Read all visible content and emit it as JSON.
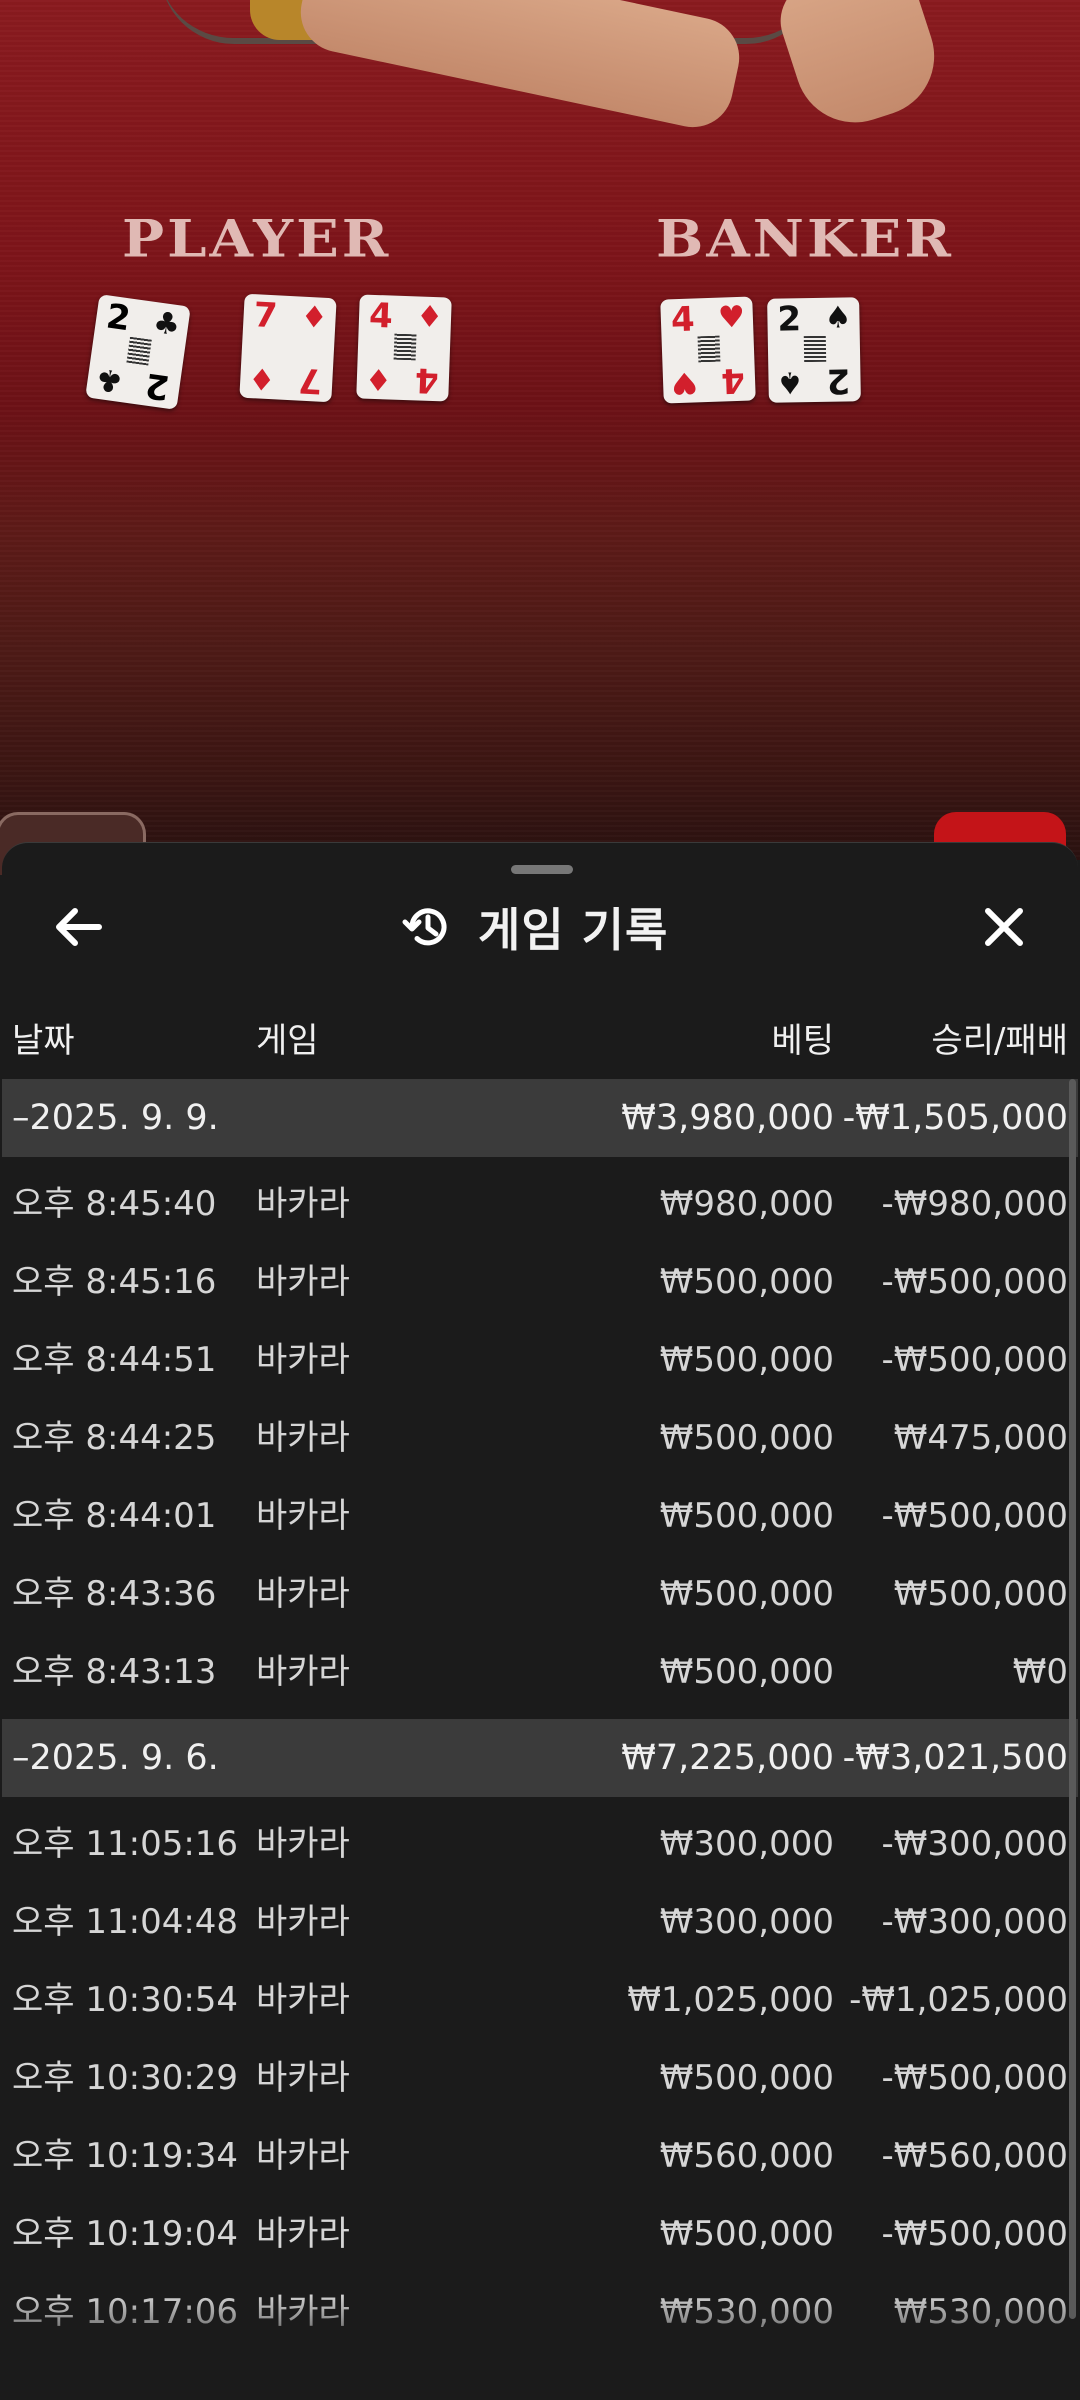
{
  "table": {
    "player_label": "PLAYER",
    "banker_label": "BANKER",
    "player_cards": [
      {
        "rank": "2",
        "suit": "♣",
        "color": "black"
      },
      {
        "rank": "7",
        "suit": "♦",
        "color": "red"
      },
      {
        "rank": "4",
        "suit": "♦",
        "color": "red"
      }
    ],
    "banker_cards": [
      {
        "rank": "4",
        "suit": "♥",
        "color": "red"
      },
      {
        "rank": "2",
        "suit": "♠",
        "color": "black"
      }
    ]
  },
  "sheet": {
    "title": "게임 기록",
    "icons": {
      "back": "arrow-left-icon",
      "history": "history-icon",
      "close": "close-icon"
    },
    "columns": {
      "date": "날짜",
      "game": "게임",
      "bet": "베팅",
      "win_loss": "승리/패배"
    },
    "groups": [
      {
        "date": "–2025. 9. 9.",
        "bet": "₩3,980,000",
        "win_loss": "-₩1,505,000",
        "rows": [
          {
            "time": "오후 8:45:40",
            "game": "바카라",
            "bet": "₩980,000",
            "win_loss": "-₩980,000"
          },
          {
            "time": "오후 8:45:16",
            "game": "바카라",
            "bet": "₩500,000",
            "win_loss": "-₩500,000"
          },
          {
            "time": "오후 8:44:51",
            "game": "바카라",
            "bet": "₩500,000",
            "win_loss": "-₩500,000"
          },
          {
            "time": "오후 8:44:25",
            "game": "바카라",
            "bet": "₩500,000",
            "win_loss": "₩475,000"
          },
          {
            "time": "오후 8:44:01",
            "game": "바카라",
            "bet": "₩500,000",
            "win_loss": "-₩500,000"
          },
          {
            "time": "오후 8:43:36",
            "game": "바카라",
            "bet": "₩500,000",
            "win_loss": "₩500,000"
          },
          {
            "time": "오후 8:43:13",
            "game": "바카라",
            "bet": "₩500,000",
            "win_loss": "₩0"
          }
        ]
      },
      {
        "date": "–2025. 9. 6.",
        "bet": "₩7,225,000",
        "win_loss": "-₩3,021,500",
        "rows": [
          {
            "time": "오후 11:05:16",
            "game": "바카라",
            "bet": "₩300,000",
            "win_loss": "-₩300,000"
          },
          {
            "time": "오후 11:04:48",
            "game": "바카라",
            "bet": "₩300,000",
            "win_loss": "-₩300,000"
          },
          {
            "time": "오후 10:30:54",
            "game": "바카라",
            "bet": "₩1,025,000",
            "win_loss": "-₩1,025,000"
          },
          {
            "time": "오후 10:30:29",
            "game": "바카라",
            "bet": "₩500,000",
            "win_loss": "-₩500,000"
          },
          {
            "time": "오후 10:19:34",
            "game": "바카라",
            "bet": "₩560,000",
            "win_loss": "-₩560,000"
          },
          {
            "time": "오후 10:19:04",
            "game": "바카라",
            "bet": "₩500,000",
            "win_loss": "-₩500,000"
          },
          {
            "time": "오후 10:17:06",
            "game": "바카라",
            "bet": "₩530,000",
            "win_loss": "₩530,000"
          }
        ]
      }
    ]
  },
  "colors": {
    "sheet_bg": "#1b1b1b",
    "group_row_bg": "#3b3b3b",
    "felt_red": "#7d1419",
    "card_red": "#d21f2c"
  }
}
